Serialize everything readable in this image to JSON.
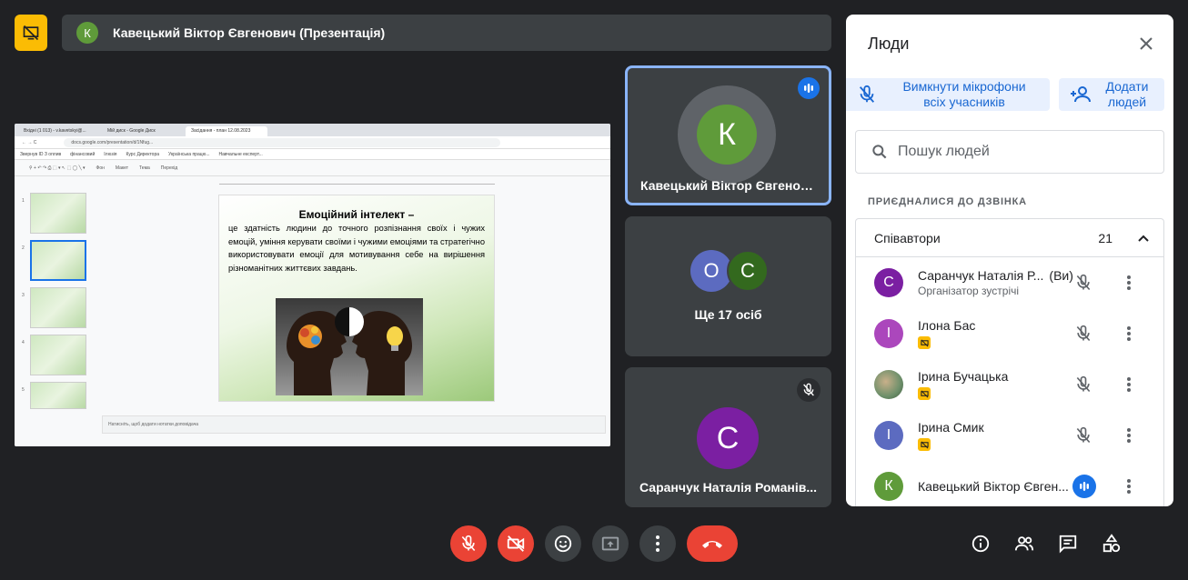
{
  "meeting": {
    "presenter_initial": "К",
    "presenter_title": "Кавецький Віктор Євгенович (Презентація)"
  },
  "shared_screen": {
    "tabs": [
      "Вхідні (1 013) - v.kavetskyi@...",
      "Мій диск - Google Диск",
      "Засідання - план 12.08.2023"
    ],
    "url": "docs.google.com/presentation/d/1Nfug...",
    "bookmarks": [
      "Звернув ID З оплив",
      "фінансовий",
      "Ілюзія",
      "Курс Директора",
      "Українська працю...",
      "Навчальне експерт..."
    ],
    "toolbar_items": [
      "Фон",
      "Макет",
      "Тема",
      "Перехід"
    ],
    "slide_title": "Емоційний інтелект –",
    "slide_text": "це здатність людини до точного розпізнання своїх і чужих емоцій, уміння керувати своїми і чужими емоціями та стратегічно використовувати емоції для мотивування себе на вирішення різноманітних життєвих завдань.",
    "notes_placeholder": "Натисніть, щоб додати нотатки доповідача",
    "thumb_numbers": [
      "1",
      "2",
      "3",
      "4",
      "5"
    ]
  },
  "tiles": {
    "main": {
      "initial": "К",
      "name": "Кавецький Віктор Євгенов..."
    },
    "group": {
      "initials": [
        "О",
        "С"
      ],
      "label": "Ще 17 осіб"
    },
    "third": {
      "initial": "С",
      "name": "Саранчук Наталія Романів..."
    }
  },
  "panel": {
    "title": "Люди",
    "mute_all": "Вимкнути мікрофони всіх учасників",
    "add_people": "Додати людей",
    "search_placeholder": "Пошук людей",
    "section_header": "ПРИЄДНАЛИСЯ ДО ДЗВІНКА",
    "group_label": "Співавтори",
    "group_count": "21",
    "people": [
      {
        "initial": "С",
        "name": "Саранчук Наталія Р...",
        "you": "(Ви)",
        "role": "Організатор зустрічі",
        "color": "#7b1fa2"
      },
      {
        "initial": "І",
        "name": "Ілона Бас",
        "color": "#ab47bc"
      },
      {
        "initial": "",
        "name": "Ірина Бучацька",
        "color": "#6d8f6a"
      },
      {
        "initial": "І",
        "name": "Ірина Смик",
        "color": "#5c6bc0"
      },
      {
        "initial": "К",
        "name": "Кавецький Віктор Євген...",
        "color": "#5f9b3a"
      }
    ]
  },
  "colors": {
    "background": "#202124",
    "tile": "#3c4043",
    "accent": "#1a73e8",
    "danger": "#ea4335",
    "present": "#fbbc04"
  },
  "controls": [
    "mic-off-icon",
    "camera-off-icon",
    "emoji-icon",
    "present-screen-icon",
    "more-options-icon",
    "hang-up-icon"
  ],
  "right_controls": [
    "info-icon",
    "people-icon",
    "chat-icon",
    "activities-icon"
  ]
}
